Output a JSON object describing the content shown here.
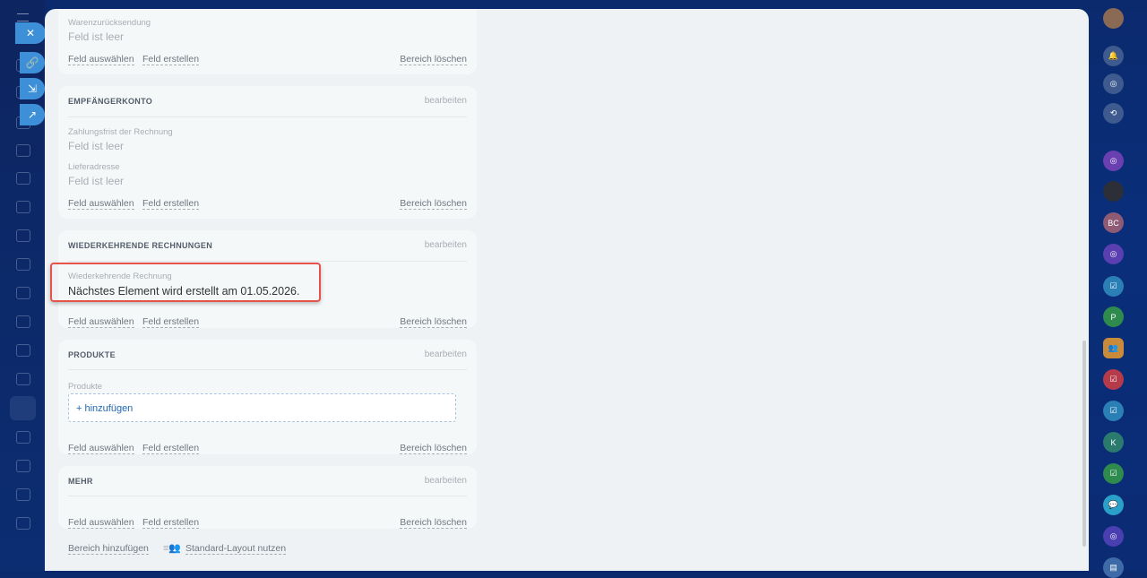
{
  "sections": [
    {
      "fields": [
        {
          "label": "Warenzurücksendung",
          "value": "Feld ist leer"
        }
      ],
      "links": {
        "select": "Feld auswählen",
        "create": "Feld erstellen",
        "delete": "Bereich löschen"
      }
    },
    {
      "title": "EMPFÄNGERKONTO",
      "edit": "bearbeiten",
      "fields": [
        {
          "label": "Zahlungsfrist der Rechnung",
          "value": "Feld ist leer"
        },
        {
          "label": "Lieferadresse",
          "value": "Feld ist leer"
        }
      ],
      "links": {
        "select": "Feld auswählen",
        "create": "Feld erstellen",
        "delete": "Bereich löschen"
      }
    },
    {
      "title": "WIEDERKEHRENDE RECHNUNGEN",
      "edit": "bearbeiten",
      "fields": [
        {
          "label": "Wiederkehrende Rechnung",
          "value": "Nächstes Element wird erstellt am 01.05.2026."
        }
      ],
      "links": {
        "select": "Feld auswählen",
        "create": "Feld erstellen",
        "delete": "Bereich löschen"
      }
    },
    {
      "title": "PRODUKTE",
      "edit": "bearbeiten",
      "fields": [
        {
          "label": "Produkte",
          "value": "+ hinzufügen"
        }
      ],
      "links": {
        "select": "Feld auswählen",
        "create": "Feld erstellen",
        "delete": "Bereich löschen"
      }
    },
    {
      "title": "MEHR",
      "edit": "bearbeiten",
      "links": {
        "select": "Feld auswählen",
        "create": "Feld erstellen",
        "delete": "Bereich löschen"
      }
    }
  ],
  "footer": {
    "add_section": "Bereich hinzufügen",
    "standard_layout": "Standard-Layout nutzen"
  },
  "right_bar": {
    "badges": [
      "BC",
      "P",
      "K"
    ]
  },
  "colors": {
    "accent": "#3d8fd8",
    "highlight": "#e5534b",
    "link_blue": "#2067b0"
  }
}
